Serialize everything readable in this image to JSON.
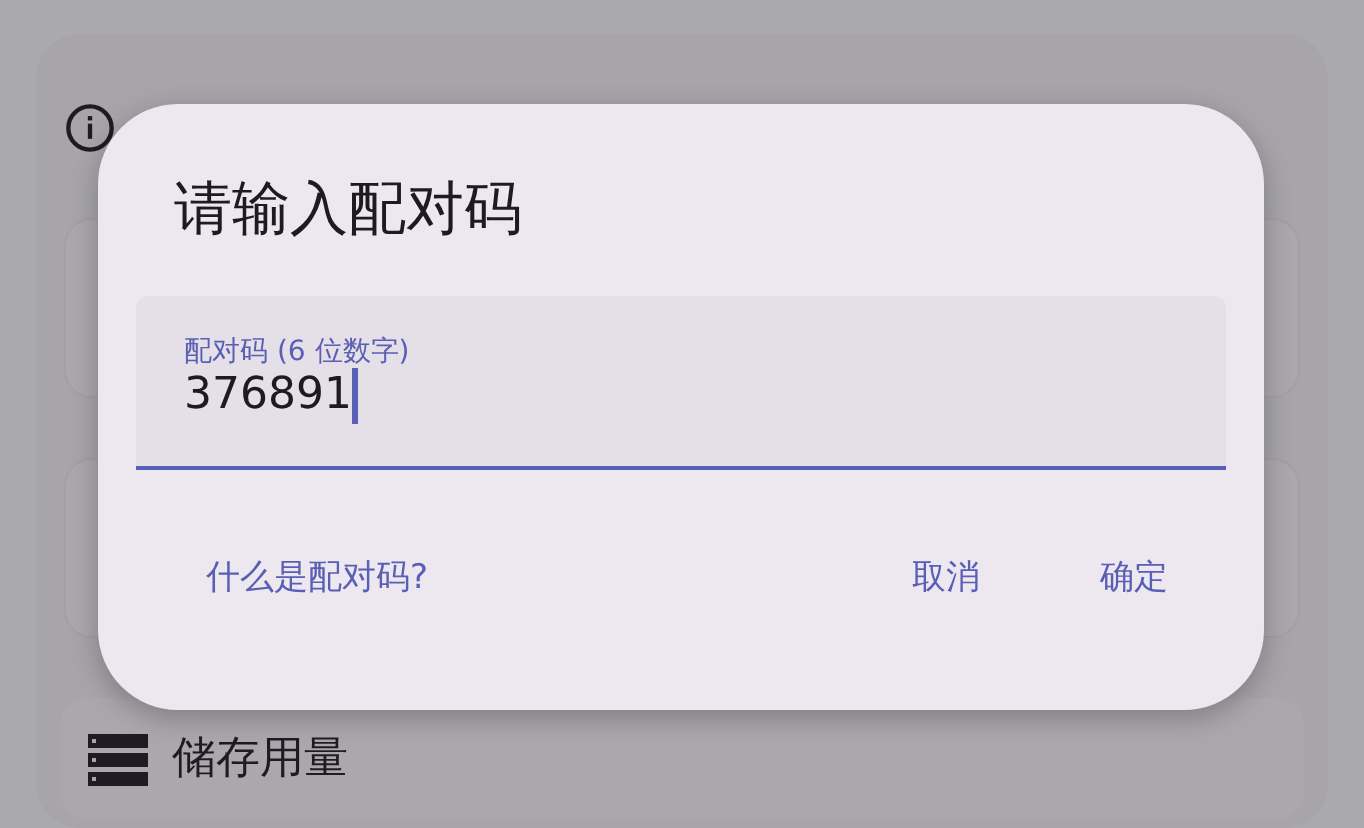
{
  "background": {
    "storage_title": "储存用量"
  },
  "dialog": {
    "title": "请输入配对码",
    "field": {
      "label": "配对码 (6 位数字)",
      "value": "376891",
      "focused": true
    },
    "help_link": "什么是配对码?",
    "buttons": [
      "取消",
      "确定"
    ]
  }
}
